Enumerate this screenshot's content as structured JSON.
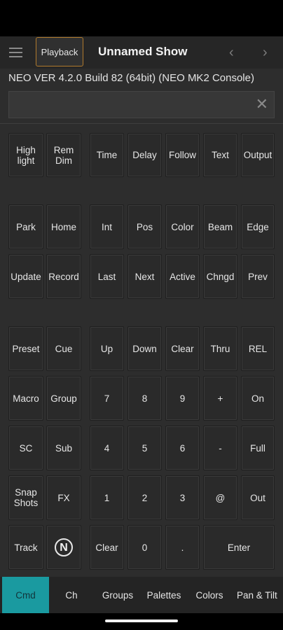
{
  "header": {
    "playback_label": "Playback",
    "show_title": "Unnamed Show",
    "prev_label": "‹",
    "next_label": "›"
  },
  "version_text": "NEO VER 4.2.0 Build 82 (64bit) (NEO MK2 Console)",
  "command_line": {
    "value": "",
    "clear_icon": "close-icon",
    "clear_label": "✕"
  },
  "keys": {
    "highlight": "High\nlight",
    "rem_dim": "Rem\nDim",
    "time": "Time",
    "delay": "Delay",
    "follow": "Follow",
    "text": "Text",
    "output": "Output",
    "park": "Park",
    "home": "Home",
    "int": "Int",
    "pos": "Pos",
    "color": "Color",
    "beam": "Beam",
    "edge": "Edge",
    "update": "Update",
    "record": "Record",
    "last": "Last",
    "next": "Next",
    "active": "Active",
    "chngd": "Chngd",
    "prev": "Prev",
    "preset": "Preset",
    "cue": "Cue",
    "up": "Up",
    "down": "Down",
    "clear": "Clear",
    "thru": "Thru",
    "rel": "REL",
    "macro": "Macro",
    "group": "Group",
    "seven": "7",
    "eight": "8",
    "nine": "9",
    "plus": "+",
    "on": "On",
    "sc": "SC",
    "sub": "Sub",
    "four": "4",
    "five": "5",
    "six": "6",
    "minus": "-",
    "full": "Full",
    "snapshots": "Snap\nShots",
    "fx": "FX",
    "one": "1",
    "two": "2",
    "three": "3",
    "at": "@",
    "out": "Out",
    "track": "Track",
    "logo": "N",
    "clear2": "Clear",
    "zero": "0",
    "dot": ".",
    "enter": "Enter"
  },
  "tabs": [
    {
      "label": "Cmd",
      "active": true
    },
    {
      "label": "Ch",
      "active": false
    },
    {
      "label": "Groups",
      "active": false
    },
    {
      "label": "Palettes",
      "active": false
    },
    {
      "label": "Colors",
      "active": false
    },
    {
      "label": "Pan & Tilt",
      "active": false
    }
  ],
  "colors": {
    "accent": "#1a9aa0",
    "playback_border": "#b07a2c",
    "background": "#2d2d2d"
  }
}
